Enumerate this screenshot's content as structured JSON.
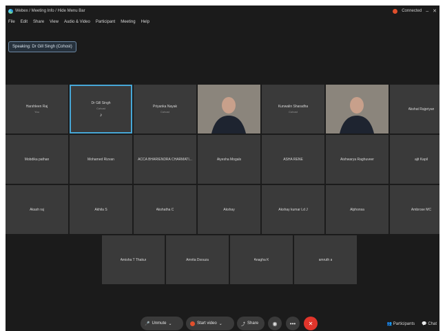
{
  "window": {
    "title": "Webex / Meeting Info / Hide Menu Bar",
    "status": "Connected"
  },
  "menu": [
    "File",
    "Edit",
    "Share",
    "View",
    "Audio & Video",
    "Participant",
    "Meeting",
    "Help"
  ],
  "speaking_label": "Speaking: Dr Gill Singh (Cohost)",
  "participants": [
    {
      "name": "Harshleen Raj",
      "sub": "You",
      "video": false
    },
    {
      "name": "Dr Gill Singh",
      "sub": "Cohost",
      "video": false,
      "active": true
    },
    {
      "name": "Priyanka Nayak",
      "sub": "Cohost",
      "video": false
    },
    {
      "name": "",
      "sub": "",
      "video": true
    },
    {
      "name": "Kunwalin Sharadha",
      "sub": "Cohost",
      "video": false
    },
    {
      "name": "",
      "sub": "",
      "video": true
    },
    {
      "name": "Akshat Rajpriyan",
      "sub": "",
      "video": false
    },
    {
      "name": "Mobdika pathan",
      "sub": "",
      "video": false
    },
    {
      "name": "Mohamed Rizvan",
      "sub": "",
      "video": false
    },
    {
      "name": "ACCA BHARIENDRA CHARMATI...",
      "sub": "",
      "video": false
    },
    {
      "name": "Aiyesha Mogals",
      "sub": "",
      "video": false
    },
    {
      "name": "ASHA RENE",
      "sub": "",
      "video": false
    },
    {
      "name": "Aishwarya Raghuveer",
      "sub": "",
      "video": false
    },
    {
      "name": "ajit Kapil",
      "sub": "",
      "video": false
    },
    {
      "name": "Akash raj",
      "sub": "",
      "video": false
    },
    {
      "name": "Akhila S",
      "sub": "",
      "video": false
    },
    {
      "name": "Akshatha C",
      "sub": "",
      "video": false
    },
    {
      "name": "Akshay",
      "sub": "",
      "video": false
    },
    {
      "name": "Akshay kumar Ld J",
      "sub": "",
      "video": false
    },
    {
      "name": "Alphonsa",
      "sub": "",
      "video": false
    },
    {
      "name": "Ambrose MC",
      "sub": "",
      "video": false
    },
    {
      "name": "Amisha T Thakur",
      "sub": "",
      "video": false
    },
    {
      "name": "Amrita Dsouza",
      "sub": "",
      "video": false
    },
    {
      "name": "Anagha K",
      "sub": "",
      "video": false
    },
    {
      "name": "amruth a",
      "sub": "",
      "video": false
    }
  ],
  "toolbar": {
    "unmute": "Unmute",
    "start_video": "Start video",
    "share": "Share",
    "participants": "Participants",
    "chat": "Chat"
  },
  "icons": {
    "mic_muted": "🎤",
    "more": "•••",
    "leave": "✕",
    "chat": "💬",
    "participants": "👥"
  },
  "colors": {
    "background": "#1b1b1b",
    "tile": "#3a3a3a",
    "active_border": "#47a8d8",
    "leave": "#e2352b"
  }
}
